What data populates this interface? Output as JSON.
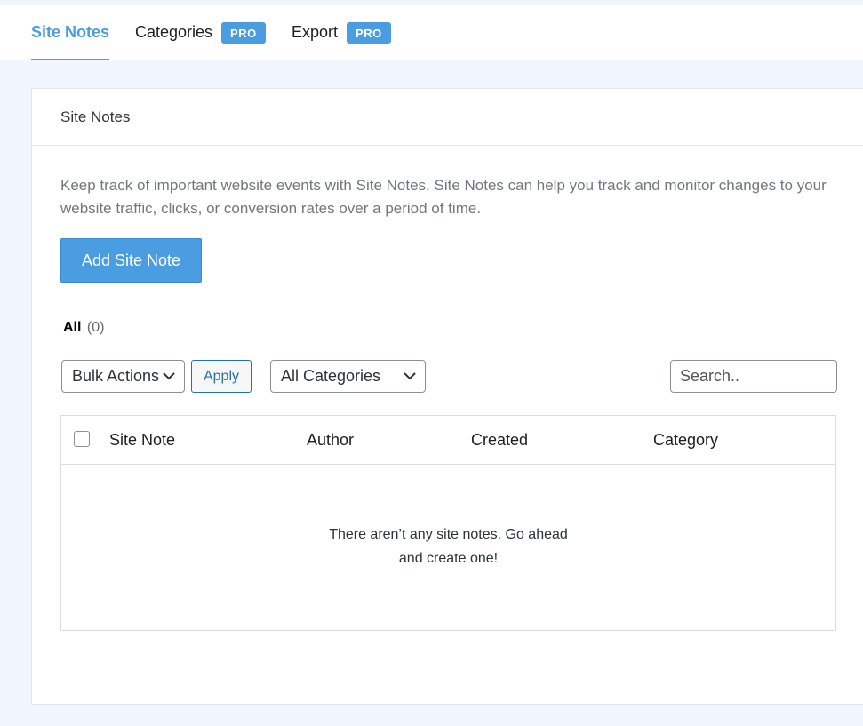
{
  "tabs": [
    {
      "label": "Site Notes",
      "active": true,
      "badge": ""
    },
    {
      "label": "Categories",
      "active": false,
      "badge": "PRO"
    },
    {
      "label": "Export",
      "active": false,
      "badge": "PRO"
    }
  ],
  "panel": {
    "title": "Site Notes",
    "description": "Keep track of important website events with Site Notes. Site Notes can help you track and monitor changes to your website traffic, clicks, or conversion rates over a period of time.",
    "add_button": "Add Site Note"
  },
  "filter": {
    "label": "All",
    "count": "(0)"
  },
  "toolbar": {
    "bulk_actions": "Bulk Actions",
    "apply": "Apply",
    "categories": "All Categories",
    "search_placeholder": "Search.."
  },
  "table": {
    "columns": [
      "Site Note",
      "Author",
      "Created",
      "Category"
    ],
    "empty_line1": "There aren’t any site notes. Go ahead",
    "empty_line2": "and create one!"
  },
  "colors": {
    "accent": "#4a9de0",
    "background": "#f1f6fd"
  }
}
